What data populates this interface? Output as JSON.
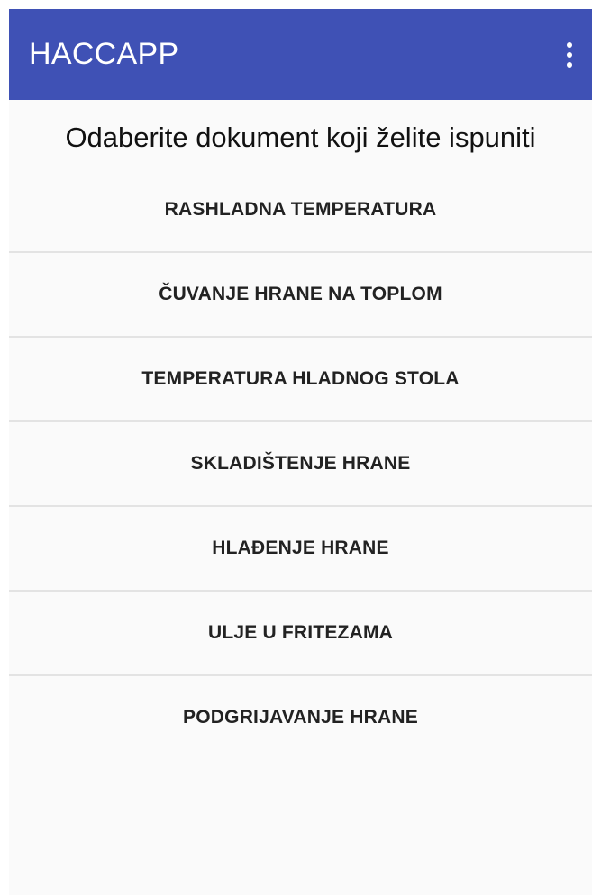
{
  "app_bar": {
    "title": "HACCAPP",
    "overflow_icon": "more-vert-icon",
    "color": "#3f51b5"
  },
  "main": {
    "heading": "Odaberite dokument koji želite ispuniti",
    "documents": [
      {
        "label": "RASHLADNA TEMPERATURA"
      },
      {
        "label": "ČUVANJE HRANE NA TOPLOM"
      },
      {
        "label": "TEMPERATURA HLADNOG STOLA"
      },
      {
        "label": "SKLADIŠTENJE HRANE"
      },
      {
        "label": "HLAĐENJE HRANE"
      },
      {
        "label": "ULJE U FRITEZAMA"
      },
      {
        "label": "PODGRIJAVANJE HRANE"
      }
    ]
  }
}
